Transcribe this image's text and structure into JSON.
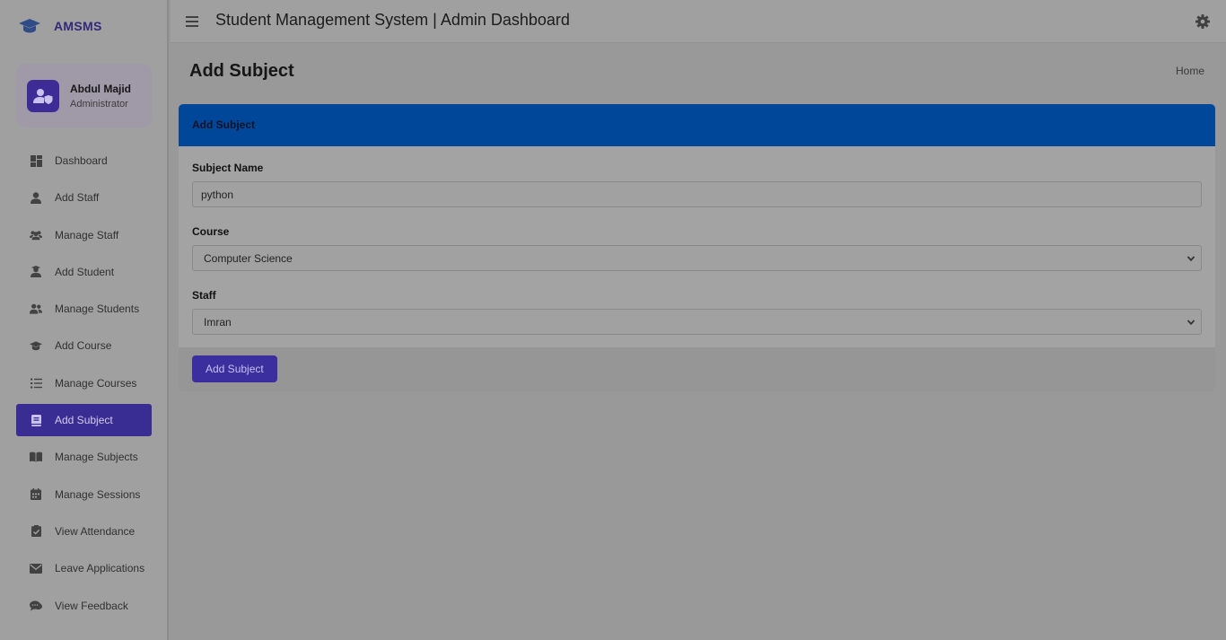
{
  "brand": {
    "name": "AMSMS"
  },
  "user": {
    "name": "Abdul Majid",
    "role": "Administrator"
  },
  "sidebar": {
    "items": [
      {
        "label": "Dashboard",
        "icon": "dashboard-icon"
      },
      {
        "label": "Add Staff",
        "icon": "user-icon"
      },
      {
        "label": "Manage Staff",
        "icon": "users-icon"
      },
      {
        "label": "Add Student",
        "icon": "student-icon"
      },
      {
        "label": "Manage Students",
        "icon": "users-icon"
      },
      {
        "label": "Add Course",
        "icon": "graduation-cap-icon"
      },
      {
        "label": "Manage Courses",
        "icon": "list-icon"
      },
      {
        "label": "Add Subject",
        "icon": "book-icon",
        "active": true
      },
      {
        "label": "Manage Subjects",
        "icon": "open-book-icon"
      },
      {
        "label": "Manage Sessions",
        "icon": "calendar-icon"
      },
      {
        "label": "View Attendance",
        "icon": "clipboard-check-icon"
      },
      {
        "label": "Leave Applications",
        "icon": "envelope-icon"
      },
      {
        "label": "View Feedback",
        "icon": "comments-icon"
      }
    ]
  },
  "header": {
    "title": "Student Management System | Admin Dashboard"
  },
  "page": {
    "title": "Add Subject",
    "breadcrumb": "Home"
  },
  "form": {
    "card_title": "Add Subject",
    "subject_label": "Subject Name",
    "subject_value": "python",
    "course_label": "Course",
    "course_value": "Computer Science",
    "staff_label": "Staff",
    "staff_value": "Imran",
    "submit_label": "Add Subject"
  },
  "colors": {
    "accent": "#392d93",
    "card_header": "#00479a",
    "overlay_background": "#999999"
  }
}
